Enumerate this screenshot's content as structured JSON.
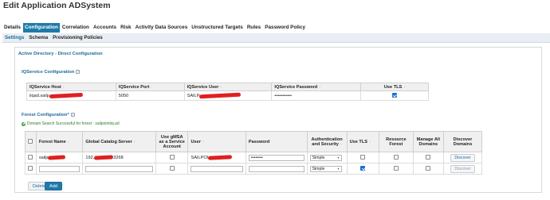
{
  "page": {
    "title": "Edit Application ADSystem"
  },
  "tabs": [
    "Details",
    "Configuration",
    "Correlation",
    "Accounts",
    "Risk",
    "Activity Data Sources",
    "Unstructured Targets",
    "Rules",
    "Password Policy"
  ],
  "active_tab": "Configuration",
  "subtabs": [
    "Settings",
    "Schema",
    "Provisioning Policies"
  ],
  "active_subtab": "Settings",
  "section_title": "Active Directory - Direct Configuration",
  "iqservice": {
    "title": "IQService Configuration",
    "headers": [
      "IQService Host",
      "IQService Port",
      "IQService User",
      "IQService Password",
      "Use TLS"
    ],
    "row": {
      "host": "iiqad.sailp",
      "port": "5050",
      "user": "SAILP",
      "password": "•••••••••••",
      "use_tls": true
    }
  },
  "forest": {
    "title": "Forest Configuration*",
    "success_message": "Domain Search Successful for forest : sailpointiiq.ad",
    "headers": [
      "Forest Name",
      "Global Catalog Server",
      "Use gMSA as a Service Account",
      "User",
      "Password",
      "Authentication and Security",
      "Use TLS",
      "Resource Forest",
      "Manage All Domains",
      "Discover Domains"
    ],
    "rows": [
      {
        "forest_name": "sailp",
        "gc_server": "192.",
        "gc_port": "3268",
        "gmsa": false,
        "user": "SAILPOI",
        "password": "••••••••",
        "auth": "Simple",
        "use_tls": false,
        "resource_forest": false,
        "manage_all": false,
        "discover": "Discover"
      },
      {
        "forest_name": "",
        "gc_server": "",
        "gc_port": "",
        "gmsa": false,
        "user": "",
        "password": "",
        "auth": "Simple",
        "use_tls": true,
        "resource_forest": false,
        "manage_all": false,
        "discover": "Discover"
      }
    ]
  },
  "buttons": {
    "delete": "Delete",
    "add": "Add"
  },
  "colors": {
    "accent": "#1e7aa9",
    "section_title": "#1e6a97",
    "success": "#2d7a2d",
    "redaction": "#e02020"
  }
}
